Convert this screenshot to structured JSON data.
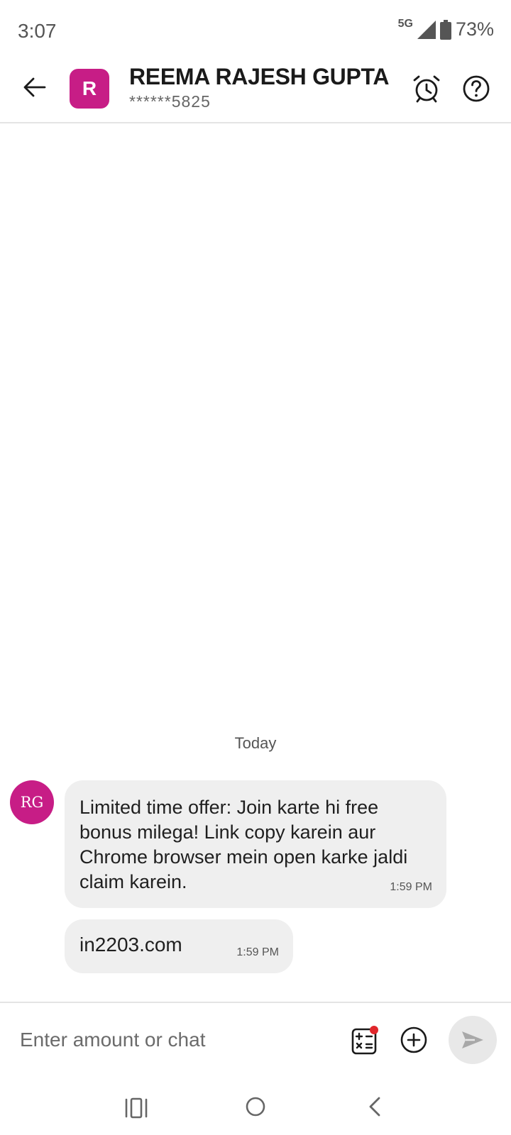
{
  "status_bar": {
    "time": "3:07",
    "network": "5G",
    "battery": "73%"
  },
  "header": {
    "avatar_letter": "R",
    "name": "REEMA RAJESH GUPTA",
    "masked_number": "******5825"
  },
  "chat": {
    "date_separator": "Today",
    "sender_initials": "RG",
    "messages": [
      {
        "text": "Limited time offer: Join karte hi free bonus milega! Link copy karein aur Chrome browser mein open karke jaldi claim karein.",
        "time": "1:59 PM"
      },
      {
        "text": "in2203.com",
        "time": "1:59 PM"
      }
    ]
  },
  "input_bar": {
    "placeholder": "Enter amount or chat",
    "value": ""
  },
  "colors": {
    "brand": "#c71d86",
    "bubble": "#efefef",
    "notification_dot": "#e0262b"
  },
  "icons": [
    "back-arrow-icon",
    "alarm-clock-icon",
    "help-icon",
    "calculator-icon",
    "add-circle-icon",
    "send-icon",
    "recents-icon",
    "home-icon",
    "nav-back-icon"
  ]
}
